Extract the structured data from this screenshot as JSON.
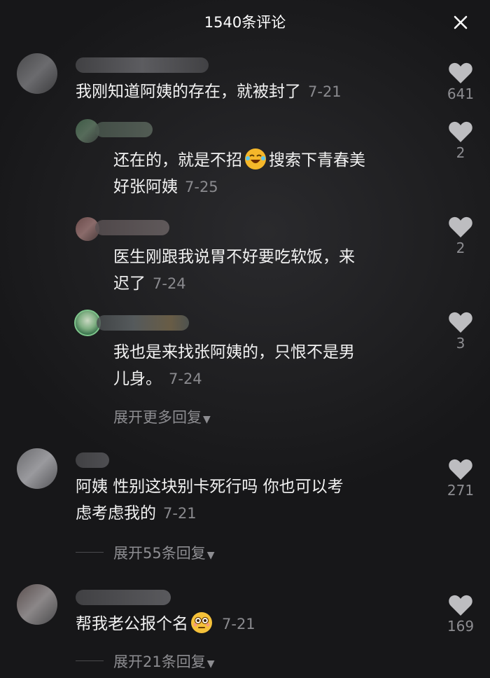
{
  "header": {
    "title": "1540条评论"
  },
  "comments": [
    {
      "text": "我刚知道阿姨的存在，就被封了",
      "date": "7-21",
      "likes": "641",
      "replies": [
        {
          "text_1": "还在的，就是不招",
          "text_2": "搜索下青春美",
          "text_3": "好张阿姨",
          "date": "7-25",
          "likes": "2",
          "emoji": "laughing-crying-emoji"
        },
        {
          "text_1": "医生刚跟我说胃不好要吃软饭，来",
          "text_2": "迟了",
          "date": "7-24",
          "likes": "2"
        },
        {
          "text_1": "我也是来找张阿姨的，只恨不是男",
          "text_2": "儿身。",
          "date": "7-24",
          "likes": "3"
        }
      ],
      "expand_label": "展开更多回复"
    },
    {
      "text_1": "阿姨 性别这块别卡死行吗 你也可以考",
      "text_2": "虑考虑我的",
      "date": "7-21",
      "likes": "271",
      "expand_label": "展开55条回复"
    },
    {
      "text": "帮我老公报个名",
      "date": "7-21",
      "likes": "169",
      "emoji": "flushed-emoji",
      "expand_label": "展开21条回复"
    }
  ],
  "colors": {
    "background": "#1b1b1d",
    "date": "#8a8a8e",
    "like_icon": "#bdbdc0"
  }
}
